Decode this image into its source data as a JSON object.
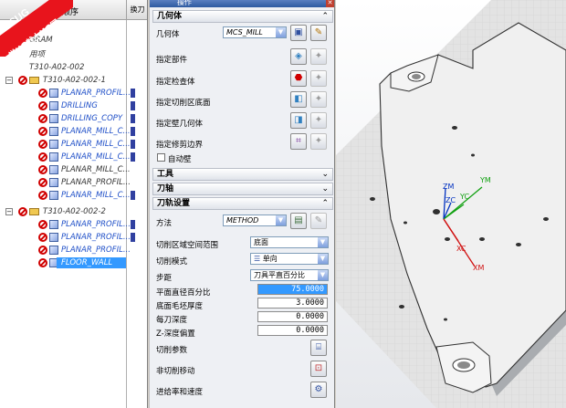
{
  "navigator": {
    "title": "程序顺序",
    "column_toolchange": "换刀",
    "rows": [
      {
        "label": "GRAM",
        "style": "grey"
      },
      {
        "label": "用项",
        "style": "grey"
      },
      {
        "label": "T310-A02-002",
        "style": "grey"
      },
      {
        "label": "T310-A02-002-1",
        "style": "grey"
      },
      {
        "label": "PLANAR_PROFIL...",
        "style": "blue"
      },
      {
        "label": "DRILLING",
        "style": "blue"
      },
      {
        "label": "DRILLING_COPY",
        "style": "blue"
      },
      {
        "label": "PLANAR_MILL_C...",
        "style": "blue"
      },
      {
        "label": "PLANAR_MILL_C...",
        "style": "blue"
      },
      {
        "label": "PLANAR_MILL_C...",
        "style": "blue"
      },
      {
        "label": "PLANAR_MILL_C...",
        "style": "grey"
      },
      {
        "label": "PLANAR_PROFIL...",
        "style": "grey"
      },
      {
        "label": "PLANAR_MILL_C...",
        "style": "blue"
      },
      {
        "label": "T310-A02-002-2",
        "style": "grey"
      },
      {
        "label": "PLANAR_PROFIL...",
        "style": "blue"
      },
      {
        "label": "PLANAR_PROFIL...",
        "style": "blue"
      },
      {
        "label": "PLANAR_PROFIL...",
        "style": "blue"
      },
      {
        "label": "FLOOR_WALL",
        "style": "selected"
      }
    ]
  },
  "watermark": {
    "brand": "9SUG",
    "slogan": "学UG就上UG网"
  },
  "dialog": {
    "title": "操作",
    "geometry": {
      "header": "几何体",
      "geometry_label": "几何体",
      "geometry_value": "MCS_MILL",
      "part_label": "指定部件",
      "check_label": "指定检查体",
      "floor_label": "指定切削区底面",
      "wall_label": "指定壁几何体",
      "trim_label": "指定修剪边界",
      "auto_wall_label": "自动壁"
    },
    "tool_header": "工具",
    "axis_header": "刀轴",
    "path": {
      "header": "刀轨设置",
      "method_label": "方法",
      "method_value": "METHOD",
      "region_label": "切削区域空间范围",
      "region_value": "底面",
      "pattern_label": "切削模式",
      "pattern_value": "单向",
      "stepover_label": "步距",
      "stepover_value": "刀具平直百分比",
      "flat_pct_label": "平面直径百分比",
      "flat_pct_value": "75.0000",
      "floor_stock_label": "底面毛坯厚度",
      "floor_stock_value": "3.0000",
      "depth_label": "每刀深度",
      "depth_value": "0.0000",
      "z_offset_label": "Z-深度偏置",
      "z_offset_value": "0.0000",
      "cut_params_label": "切削参数",
      "noncut_label": "非切削移动",
      "feeds_label": "进给率和速度"
    }
  },
  "viewport": {
    "axes": [
      "ZM",
      "ZC",
      "YC",
      "YM",
      "XC",
      "XM"
    ],
    "colors": {
      "z": "#0030c0",
      "y": "#10a010",
      "x": "#d01010"
    }
  }
}
